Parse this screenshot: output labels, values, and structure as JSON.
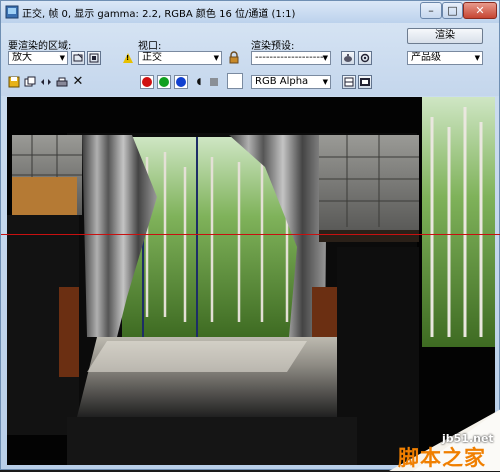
{
  "window": {
    "title": "正交, 帧 0, 显示 gamma: 2.2, RGBA 颜色 16 位/通道 (1:1)",
    "min_glyph": "–",
    "max_glyph": "□",
    "close_glyph": "✕"
  },
  "toolbar": {
    "region_label": "要渲染的区域:",
    "region_value": "放大",
    "viewport_label": "视口:",
    "viewport_value": "正交",
    "preset_label": "渲染预设:",
    "preset_value": "--------------------",
    "render_button": "渲染",
    "quality_value": "产品级",
    "channel_value": "RGB Alpha"
  },
  "colors": {
    "red_channel": "#d01010",
    "green_channel": "#10a020",
    "blue_channel": "#1040d0",
    "red_line": "#c81010",
    "watermark_orange": "#f07f00"
  },
  "watermark": {
    "url": "jb51.net",
    "main": "脚本之家"
  }
}
